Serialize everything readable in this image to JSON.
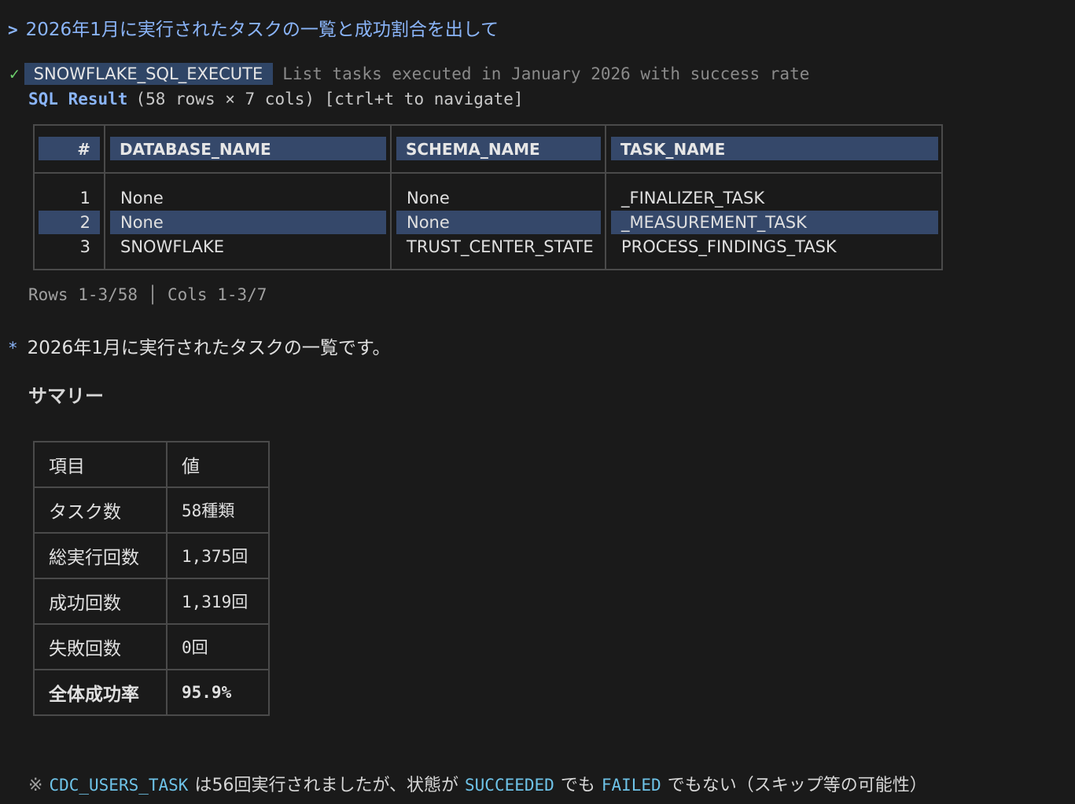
{
  "prompt": {
    "chevron": ">",
    "text": "2026年1月に実行されたタスクの一覧と成功割合を出して"
  },
  "tool": {
    "check": "✓",
    "name": "SNOWFLAKE_SQL_EXECUTE",
    "description": "List tasks executed in January 2026 with success rate"
  },
  "sql_result": {
    "label": "SQL Result",
    "info": "(58 rows × 7 cols) [ctrl+t to navigate]"
  },
  "table": {
    "headers": [
      "#",
      "DATABASE_NAME",
      "SCHEMA_NAME",
      "TASK_NAME"
    ],
    "rows": [
      [
        "1",
        "None",
        "None",
        "_FINALIZER_TASK"
      ],
      [
        "2",
        "None",
        "None",
        "_MEASUREMENT_TASK"
      ],
      [
        "3",
        "SNOWFLAKE",
        "TRUST_CENTER_STATE",
        "PROCESS_FINDINGS_TASK"
      ]
    ],
    "selected_row": 2
  },
  "pagination": "Rows 1-3/58 │ Cols 1-3/7",
  "answer": {
    "bullet": "*",
    "text": "2026年1月に実行されたタスクの一覧です。"
  },
  "summary": {
    "title": "サマリー",
    "header": {
      "key": "項目",
      "value": "値"
    },
    "rows": [
      {
        "key": "タスク数",
        "value": "58種類"
      },
      {
        "key": "総実行回数",
        "value": "1,375回"
      },
      {
        "key": "成功回数",
        "value": "1,319回"
      },
      {
        "key": "失敗回数",
        "value": "0回"
      },
      {
        "key": "全体成功率",
        "value": "95.9%"
      }
    ]
  },
  "note": {
    "mark": "※",
    "task": "CDC_USERS_TASK",
    "text1": "は56回実行されましたが、状態が",
    "state1": "SUCCEEDED",
    "text2": "でも",
    "state2": "FAILED",
    "text3": "でもない（スキップ等の可能性）"
  }
}
